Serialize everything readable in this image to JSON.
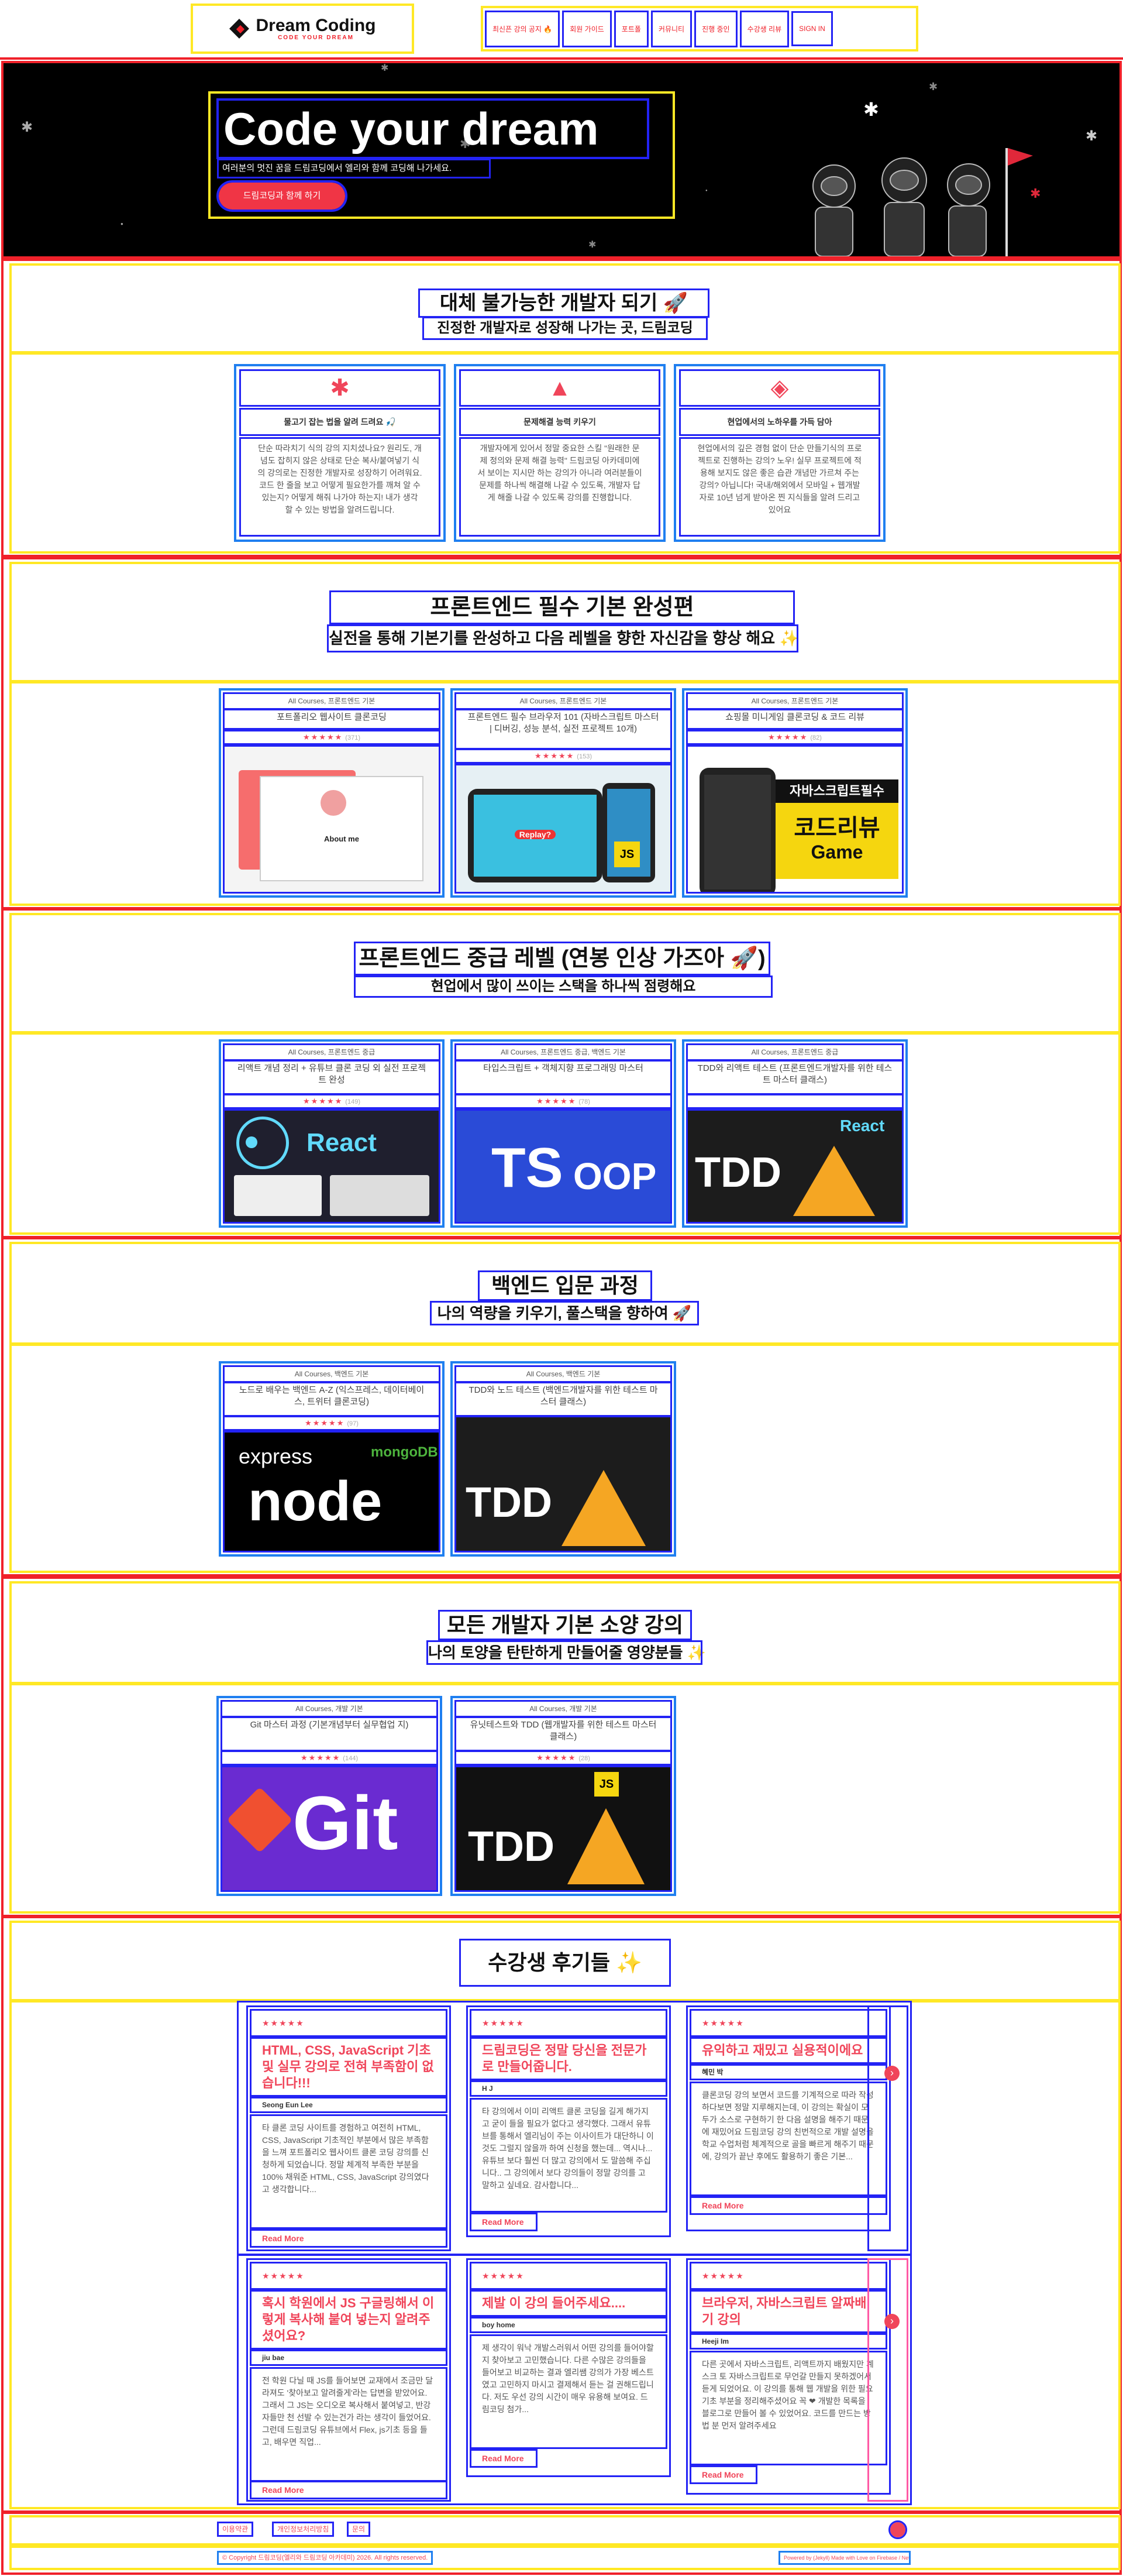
{
  "header": {
    "brand": "Dream Coding",
    "brand_sub": "CODE YOUR DREAM",
    "nav": [
      "최신픈 강의 공지 🔥",
      "회원 가이드",
      "포트폴",
      "커뮤니티",
      "진행 중인",
      "수강생 리뷰",
      "SIGN IN"
    ]
  },
  "hero": {
    "title": "Code your dream",
    "subtitle": "여러분의 멋진 꿈을 드림코딩에서 엘리와 함께 코딩해 나가세요.",
    "cta": "드림코딩과 함께 하기"
  },
  "intro": {
    "title": "대체 불가능한 개발자 되기 🚀",
    "subtitle": "진정한 개발자로 성장해 나가는 곳, 드림코딩",
    "features": [
      {
        "icon": "✱",
        "title": "물고기 잡는 법을 알려 드려요 🎣",
        "desc": "단순 따라치기 식의 강의 지치셨나요? 원리도, 개념도 잡히지 않은 상태로 단순 복사/붙여넣기 식의 강의로는 진정한 개발자로 성장하기 어려워요. 코드 한 줄을 보고 어떻게 필요한가를 깨쳐 알 수 있는지? 어떻게 해줘 나가야 하는지! 내가 생각 할 수 있는 방법을 알려드립니다."
      },
      {
        "icon": "▲",
        "title": "문제해결 능력 키우기",
        "desc": "개발자에게 있어서 정말 중요한 스킬 \"원래한 문제 정의와 문제 해결 능력\" 드림코딩 아카데미에서 보이는 지시만 하는 강의가 아니라 여러분들이 문제를 하나씩 해결해 나갈 수 있도록, 개발자 답게 해줄 나갈 수 있도록 강의를 진행합니다."
      },
      {
        "icon": "◈",
        "title": "현업에서의 노하우를 가득 담아",
        "desc": "현업에서의 깊은 경험 없이 단순 만들기식의 프로젝트로 진행하는 강의? 노우! 실무 프로젝트에 적용해 보지도 않은 좋은 습관 개념만 가르쳐 주는 강의? 아닙니다! 국내/해외에서 모바일 + 웹개발자로 10년 넘게 받아온 찐 지식들을 알려 드리고 있어요"
      }
    ]
  },
  "basic": {
    "title": "프론트엔드 필수 기본 완성편",
    "subtitle": "실전을 통해 기본기를 완성하고 다음 레벨을 향한 자신감을 향상 해요 ✨",
    "cards": [
      {
        "category": "All Courses, 프론트엔드 기본",
        "title": "포트폴리오 웹사이트 클론코딩",
        "stars": "★★★★★",
        "count": "(371)",
        "thumb": "About me"
      },
      {
        "category": "All Courses, 프론트엔드 기본",
        "title": "프론트엔드 필수 브라우저 101 (자바스크립트 마스터 | 디버깅, 성능 분석, 실전 프로젝트 10개)",
        "stars": "★★★★★",
        "count": "(153)",
        "thumb": "Replay?"
      },
      {
        "category": "All Courses, 프론트엔드 기본",
        "title": "쇼핑몰 미니게임 클론코딩 & 코드 리뷰",
        "stars": "★★★★★",
        "count": "(82)",
        "thumb_tag": "자바스크립트필수",
        "thumb_main": "코드리뷰",
        "thumb_sub": "Game"
      }
    ]
  },
  "intermediate": {
    "title": "프론트엔드 중급 레벨 (연봉 인상 가즈아 🚀)",
    "subtitle": "현업에서 많이 쓰이는 스택을 하나씩 점령해요",
    "cards": [
      {
        "category": "All Courses, 프론트엔드 중급",
        "title": "리액트 개념 정리 + 유튜브 클론 코딩 외 실전 프로젝트 완성",
        "stars": "★★★★★",
        "count": "(149)",
        "thumb": "React"
      },
      {
        "category": "All Courses, 프론트엔드 중급, 백엔드 기본",
        "title": "타입스크립트 + 객체지향 프로그래밍 마스터",
        "stars": "★★★★★",
        "count": "(78)",
        "thumb_a": "TS",
        "thumb_b": "OOP"
      },
      {
        "category": "All Courses, 프론트엔드 중급",
        "title": "TDD와 리액트 테스트 (프론트엔드개발자를 위한 테스트 마스터 클래스)",
        "stars": "",
        "count": "",
        "thumb": "TDD",
        "thumb_b": "React"
      }
    ]
  },
  "backend": {
    "title": "백엔드 입문 과정",
    "subtitle": "나의 역량을 키우기, 풀스택을 향하여 🚀",
    "cards": [
      {
        "category": "All Courses, 백엔드 기본",
        "title": "노드로 배우는 백엔드 A-Z (익스프레스, 데이터베이스, 트위터 클론코딩)",
        "stars": "★★★★★",
        "count": "(97)",
        "thumb": "node",
        "thumb_b": "express",
        "thumb_c": "mongoDB"
      },
      {
        "category": "All Courses, 백엔드 기본",
        "title": "TDD와 노드 테스트 (백엔드개발자를 위한 테스트 마스터 클래스)",
        "stars": "",
        "count": "",
        "thumb": "TDD"
      }
    ]
  },
  "essentials": {
    "title": "모든 개발자 기본 소양 강의",
    "subtitle": "나의 토양을 탄탄하게 만들어줄 영양분들 ✨",
    "cards": [
      {
        "category": "All Courses, 개발 기본",
        "title": "Git 마스터 과정 (기본개념부터 실무협업 지)",
        "stars": "★★★★★",
        "count": "(144)",
        "thumb": "Git"
      },
      {
        "category": "All Courses, 개발 기본",
        "title": "유닛테스트와 TDD (웹개발자를 위한 테스트 마스터 클래스)",
        "stars": "★★★★★",
        "count": "(28)",
        "thumb": "TDD",
        "thumb_b": "JS"
      }
    ]
  },
  "reviews": {
    "title": "수강생 후기들 ✨",
    "more": "Read More",
    "row1": [
      {
        "stars": "★★★★★",
        "title": "HTML, CSS, JavaScript 기초 및 실무 강의로 전혀 부족함이 없습니다!!!",
        "author": "Seong Eun Lee",
        "body": "타 클론 코딩 사이트를 경험하고 여전히 HTML, CSS, JavaScript 기초적인 부분에서 많은 부족함을 느껴 포트폴리오 웹사이트 클론 코딩 강의를 신청하게 되었습니다. 정말 체계적 부족한 부분을 100% 채워준 HTML, CSS, JavaScript 강의였다고 생각합니다..."
      },
      {
        "stars": "★★★★★",
        "title": "드림코딩은 정말 당신을 전문가로 만들어줍니다.",
        "author": "H J",
        "body": "타 강의에서 이미 리액트 클론 코딩을 길게 해가지고 굳이 들을 필요가 없다고 생각했다. 그래서 유튜브를 통해서 엘리님이 주는 이사이트가 대단하니 이것도 그럴지 않을까 하여 신청을 했는데... 역시나... 유튜브 보다 훨씬 더 많고 강의에서 도 말씀해 주십니다.. 그 강의에서 보다 강의들이 정말 강의를 고 말하고 싶네요. 감사합니다..."
      },
      {
        "stars": "★★★★★",
        "title": "유익하고 재밌고 실용적이에요",
        "author": "혜민 박",
        "body": "클론코딩 강의 보면서 코드를 기계적으로 따라 작성하다보면 정말 지루해지는데, 이 강의는 확실이 모두가 소스로 구현하기 한 다음 설명을 해주기 때문에 재밌어요 드림코딩 강의 친번적으로 개발 설명을 학교 수업처럼 체계적으로 골을 빠르게 해주기 때문에, 강의가 끝난 후에도 활용하기 좋은 기본..."
      }
    ],
    "row2": [
      {
        "stars": "★★★★★",
        "title": "혹시 학원에서 JS 구글링해서 이렇게 복사해 붙여 넣는지 알려주셨어요?",
        "author": "jiu bae",
        "body": "전 학원 다닐 때 JS를 들어보면 교재에서 조금만 달라져도 '찾아보고 알려줄게'라는 답변을 받았어요. 그래서 그 JS는 오디오로 복사해서 붙여넣고, 반강자들만 천 선발 수 있는건가 라는 생각이 들었어요. 그런데 드림코딩 유튜브에서 Flex, js기초 등을 들고, 배우면 직업..."
      },
      {
        "stars": "★★★★★",
        "title": "제발 이 강의 들어주세요....",
        "author": "boy home",
        "body": "제 생각이 워낙 개발스러워서 어떤 강의를 들어야할지 찾아보고 고민했습니다. 다른 수많은 강의들을 들어보고 비교하는 결과 엘리쌤 강의가 가장 베스트였고 고민하지 마시고 결제해서 듣는 걸 권해드립니다. 저도 우선 강의 시간이 매우 유용해 보여요. 드림코딩 첨가..."
      },
      {
        "stars": "★★★★★",
        "title": "브라우저, 자바스크립트 알짜배기 강의",
        "author": "Heeji Im",
        "body": "다른 곳에서 자바스크립트, 리액트까지 배웠지만 계 스크 토 자바스크립트로 무언갈 만들지 못하겠어서 듣게 되었어요. 이 강의를 통해 웹 개발을 위한 필요 기초 부분을 정리해주셨어요 꼭 ❤ 개발한 목록을 블로그로 만들어 볼 수 있었어요. 코드를 만드는 방법 분 먼저 알려주세요"
      }
    ]
  },
  "footer": {
    "links": [
      "이용약관",
      "개인정보처리방침",
      "문의"
    ],
    "copyright": "© Copyright 드림코딩(엘리와 드림코딩 아카데미) 2026. All rights reserved.",
    "powered": "Powered by (Jekyll) Made with Love on Firebase / Netlify"
  }
}
